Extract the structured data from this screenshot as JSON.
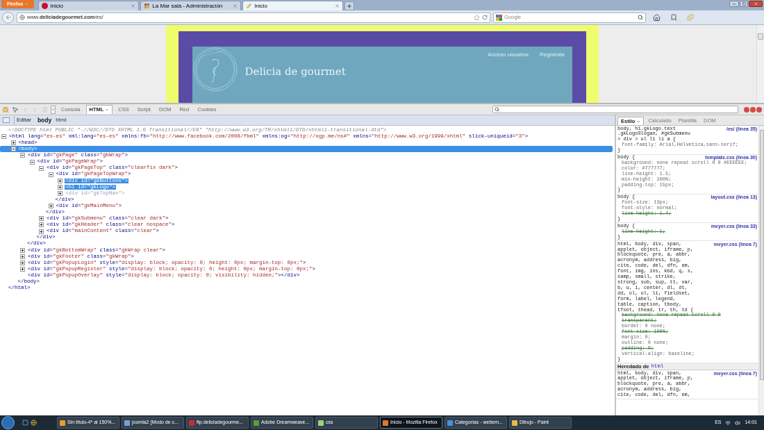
{
  "browser": {
    "menu_button": "Firefox",
    "tabs": [
      {
        "title": "Inicio",
        "selected": false,
        "kind": "w"
      },
      {
        "title": "La Mar salá - Administración",
        "selected": false,
        "kind": "joomla"
      },
      {
        "title": "Inicio",
        "selected": true,
        "kind": "leaf"
      }
    ],
    "url": "www.**deliciadegourmet.com**/es/",
    "search": {
      "placeholder": "Google"
    }
  },
  "page": {
    "site_title": "Delicia de gourmet",
    "links": [
      "Acceso usuarios",
      "Registrate"
    ]
  },
  "firebug": {
    "tabs": [
      {
        "label": "Consola",
        "selected": false
      },
      {
        "label": "HTML",
        "selected": true
      },
      {
        "label": "CSS",
        "selected": false
      },
      {
        "label": "Script",
        "selected": false
      },
      {
        "label": "DOM",
        "selected": false
      },
      {
        "label": "Red",
        "selected": false
      },
      {
        "label": "Cookies",
        "selected": false
      }
    ],
    "edit_button": "Editar",
    "breadcrumb": [
      {
        "label": "body",
        "selected": true
      },
      {
        "label": "html",
        "selected": false
      }
    ],
    "tree": [
      {
        "kind": "doctype",
        "text": "<!DOCTYPE html PUBLIC \"-//W3C//DTD XHTML 1.0 Transitional//EN\" \"http://www.w3.org/TR/xhtml1/DTD/xhtml1-transitional.dtd\">"
      },
      {
        "kind": "element",
        "text": "<html lang=\"es-es\" xml:lang=\"es-es\" xmlns:fb=\"http://www.facebook.com/2008/fbml\" xmlns:og=\"http://ogp.me/ns#\" xmlns=\"http://www.w3.org/1999/xhtml\" slick-uniqueid=\"3\">",
        "close": "</html>",
        "expanded": true,
        "selected": false,
        "highlighted": false,
        "dimmed": false,
        "children": [
          {
            "kind": "element",
            "text": "<head>",
            "expanded": false,
            "selected": false,
            "highlighted": false,
            "dimmed": false
          },
          {
            "kind": "element",
            "text": "<body>",
            "close": "</body>",
            "expanded": true,
            "selected": true,
            "highlighted": false,
            "dimmed": false,
            "children": [
              {
                "kind": "element",
                "text": "<div id=\"gkPage\" class=\"gkWrap\">",
                "close": "</div>",
                "expanded": true,
                "selected": false,
                "highlighted": false,
                "dimmed": false,
                "children": [
                  {
                    "kind": "element",
                    "text": "<div id=\"gkPageWrap\">",
                    "close": "</div>",
                    "expanded": true,
                    "selected": false,
                    "highlighted": false,
                    "dimmed": false,
                    "children": [
                      {
                        "kind": "element",
                        "text": "<div id=\"gkPageTop\" class=\"clearfix dark\">",
                        "close": "</div>",
                        "expanded": true,
                        "selected": false,
                        "highlighted": false,
                        "dimmed": false,
                        "children": [
                          {
                            "kind": "element",
                            "text": "<div id=\"gkPageTopWrap\">",
                            "close": "</div>",
                            "expanded": true,
                            "selected": false,
                            "highlighted": false,
                            "dimmed": false,
                            "children": [
                              {
                                "kind": "element",
                                "text": "<div id=\"gkButtons\">",
                                "expanded": false,
                                "selected": false,
                                "highlighted": true,
                                "dimmed": false
                              },
                              {
                                "kind": "element",
                                "text": "<h1 id=\"gkLogo\">",
                                "expanded": false,
                                "selected": false,
                                "highlighted": true,
                                "dimmed": false
                              },
                              {
                                "kind": "element",
                                "text": "<div id=\"gkTopNav\">",
                                "expanded": false,
                                "selected": false,
                                "highlighted": false,
                                "dimmed": true
                              }
                            ]
                          },
                          {
                            "kind": "element",
                            "text": "<div id=\"gkMainMenu\">",
                            "expanded": false,
                            "selected": false,
                            "highlighted": false,
                            "dimmed": false
                          }
                        ]
                      },
                      {
                        "kind": "element",
                        "text": "<div id=\"gkSubmenu\" class=\"clear dark\">",
                        "expanded": false,
                        "selected": false,
                        "highlighted": false,
                        "dimmed": false
                      },
                      {
                        "kind": "element",
                        "text": "<div id=\"gkHeader\" class=\"clear nospace\">",
                        "expanded": false,
                        "selected": false,
                        "highlighted": false,
                        "dimmed": false
                      },
                      {
                        "kind": "element",
                        "text": "<div id=\"mainContent\" class=\"clear\">",
                        "expanded": false,
                        "selected": false,
                        "highlighted": false,
                        "dimmed": false
                      }
                    ]
                  }
                ]
              },
              {
                "kind": "element",
                "text": "<div id=\"gkBottomWrap\" class=\"gkWrap clear\">",
                "expanded": false,
                "selected": false,
                "highlighted": false,
                "dimmed": false
              },
              {
                "kind": "element",
                "text": "<div id=\"gkFooter\" class=\"gkWrap\">",
                "expanded": false,
                "selected": false,
                "highlighted": false,
                "dimmed": false
              },
              {
                "kind": "element",
                "text": "<div id=\"gkPopupLogin\" style=\"display: block; opacity: 0; height: 0px; margin-top: 0px;\">",
                "expanded": false,
                "selected": false,
                "highlighted": false,
                "dimmed": false
              },
              {
                "kind": "element",
                "text": "<div id=\"gkPopupRegister\" style=\"display: block; opacity: 0; height: 0px; margin-top: 0px;\">",
                "expanded": false,
                "selected": false,
                "highlighted": false,
                "dimmed": false
              },
              {
                "kind": "element",
                "text": "<div id=\"gkPopupOverlay\" style=\"display: block; opacity: 0; visibility: hidden;\"></div>",
                "selected": false,
                "highlighted": false,
                "dimmed": false
              }
            ]
          }
        ]
      }
    ],
    "side_tabs": [
      {
        "label": "Estilo",
        "selected": true
      },
      {
        "label": "Calculado",
        "selected": false
      },
      {
        "label": "Plantilla",
        "selected": false
      },
      {
        "label": "DOM",
        "selected": false
      }
    ],
    "rules": [
      {
        "selector": [
          "body, h1.gkLogo.text",
          ".gkLogoSlogan, #gkSubmenu",
          "> div > ul li li a {"
        ],
        "source": "/es/ (línea 35)",
        "declarations": [
          {
            "text": "font-family: Arial,Helvetica,sans-serif;",
            "overridden": false
          }
        ],
        "close": "}"
      },
      {
        "selector": [
          "body {"
        ],
        "source": "template.css (línea 30)",
        "declarations": [
          {
            "text": "background: none repeat scroll 0 0 #EEEEEE;",
            "overridden": false
          },
          {
            "text": "color: #777777;",
            "overridden": false
          },
          {
            "text": "line-height: 1.5;",
            "overridden": false
          },
          {
            "text": "min-height: 100%;",
            "overridden": false
          },
          {
            "text": "padding-top: 15px;",
            "overridden": false
          }
        ],
        "close": "}"
      },
      {
        "selector": [
          "body {"
        ],
        "source": "layout.css (línea 13)",
        "declarations": [
          {
            "text": "font-size: 13px;",
            "overridden": false
          },
          {
            "text": "font-style: normal;",
            "overridden": false
          },
          {
            "text": "line-height: 1.4;",
            "overridden": true
          }
        ],
        "close": "}"
      },
      {
        "selector": [
          "body {"
        ],
        "source": "meyer.css (línea 33)",
        "declarations": [
          {
            "text": "line-height: 1;",
            "overridden": true
          }
        ],
        "close": "}"
      },
      {
        "selector": [
          "html, body, div, span,",
          "applet, object, iframe, p,",
          "blockquote, pre, a, abbr,",
          "acronym, address, big,",
          "cite, code, del, dfn, em,",
          "font, img, ins, kbd, q, s,",
          "samp, small, strike,",
          "strong, sub, sup, tt, var,",
          "b, u, i, center, dl, dt,",
          "dd, ol, ul, li, fieldset,",
          "form, label, legend,",
          "table, caption, tbody,",
          "tfoot, thead, tr, th, td {"
        ],
        "source": "meyer.css (línea 7)",
        "declarations": [
          {
            "text": "background: none repeat scroll 0 0 transparent;",
            "overridden": true
          },
          {
            "text": "border: 0 none;",
            "overridden": false
          },
          {
            "text": "font-size: 100%;",
            "overridden": true
          },
          {
            "text": "margin: 0;",
            "overridden": false
          },
          {
            "text": "outline: 0 none;",
            "overridden": false
          },
          {
            "text": "padding: 0;",
            "overridden": true
          },
          {
            "text": "vertical-align: baseline;",
            "overridden": false
          }
        ],
        "close": "}"
      }
    ],
    "inherited": {
      "label": "Heredado de",
      "element": "html"
    },
    "inherited_rules": [
      {
        "selector": [
          "html, body, div, span,",
          "applet, object, iframe, p,",
          "blockquote, pre, a, abbr,",
          "acronym, address, big,",
          "cite, code, del, dfn, em,"
        ],
        "source": "meyer.css (línea 7)"
      }
    ]
  },
  "taskbar": {
    "items": [
      {
        "title": "Sin título-4* al 150%...",
        "selected": false
      },
      {
        "title": "joomla2 [Modo de c...",
        "selected": false
      },
      {
        "title": "ftp.deliciadegourme...",
        "selected": false
      },
      {
        "title": "Adobe Dreamweave...",
        "selected": false
      },
      {
        "title": "css",
        "selected": false
      },
      {
        "title": "Inicio - Mozilla Firefox",
        "selected": true
      },
      {
        "title": "Categorías - webem...",
        "selected": false
      },
      {
        "title": "Dibujo - Paint",
        "selected": false
      }
    ],
    "language": "ES",
    "clock": "14:01"
  }
}
